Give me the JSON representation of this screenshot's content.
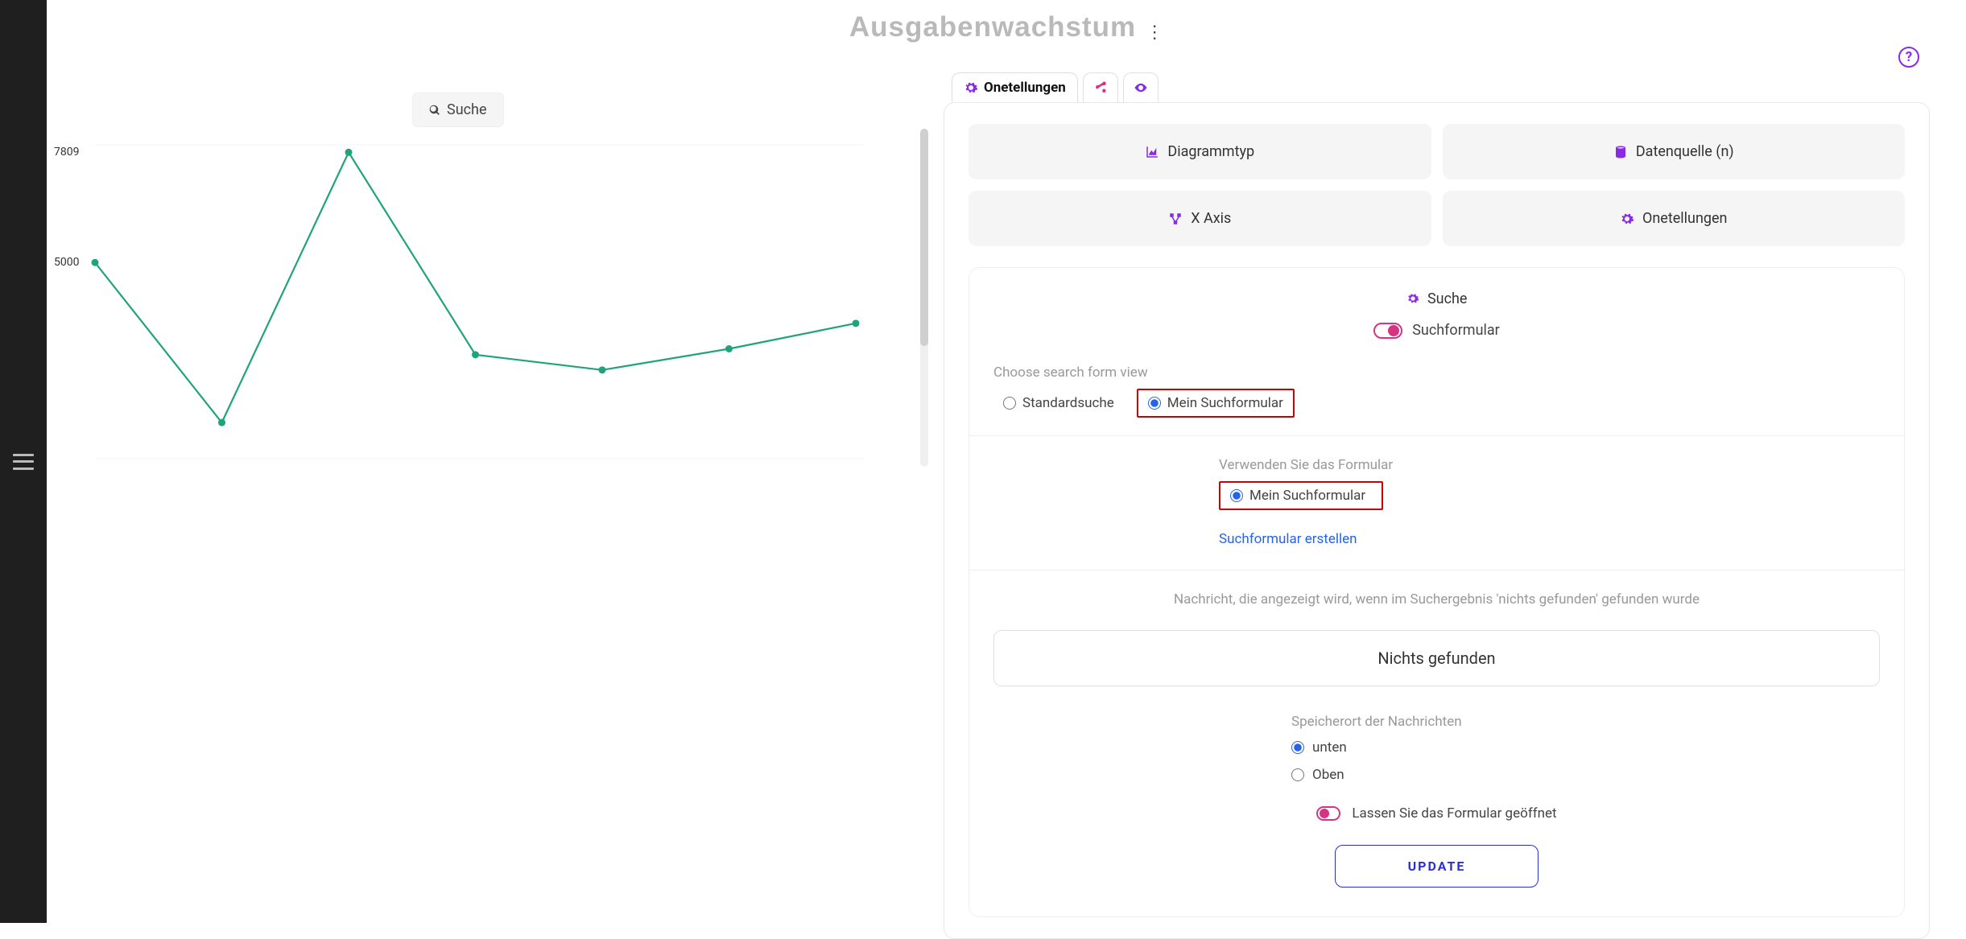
{
  "page": {
    "title": "Ausgabenwachstum",
    "help_tooltip": "?"
  },
  "chart_panel": {
    "search_label": "Suche"
  },
  "chart_data": {
    "type": "line",
    "title": "",
    "xlabel": "",
    "ylabel": "",
    "ylim": [
      0,
      8000
    ],
    "y_ticks": [
      7809,
      5000
    ],
    "x": [
      0,
      1,
      2,
      3,
      4,
      5,
      6
    ],
    "values": [
      5000,
      920,
      7809,
      2650,
      2260,
      2800,
      3450
    ]
  },
  "tabs": {
    "settings": "Onetellungen"
  },
  "options": {
    "chart_type": "Diagrammtyp",
    "data_source": "Datenquelle (n)",
    "x_axis": "X Axis",
    "settings": "Onetellungen"
  },
  "search_section": {
    "header": "Suche",
    "form_toggle_label": "Suchformular",
    "choose_view_label": "Choose search form view",
    "radio_standard": "Standardsuche",
    "radio_myform": "Mein Suchformular",
    "use_form_label": "Verwenden Sie das Formular",
    "use_form_option": "Mein Suchformular",
    "create_link": "Suchformular erstellen",
    "msg_description": "Nachricht, die angezeigt wird, wenn im Suchergebnis 'nichts gefunden' gefunden wurde",
    "msg_input_value": "Nichts gefunden",
    "location_label": "Speicherort der Nachrichten",
    "location_bottom": "unten",
    "location_top": "Oben",
    "keep_open_label": "Lassen Sie das Formular geöffnet",
    "update_button": "UPDATE"
  },
  "colors": {
    "accent_purple": "#8a2be2",
    "accent_pink": "#d63384",
    "accent_blue": "#2b2fd8",
    "chart_green": "#1fa37a",
    "highlight_red": "#c00"
  }
}
